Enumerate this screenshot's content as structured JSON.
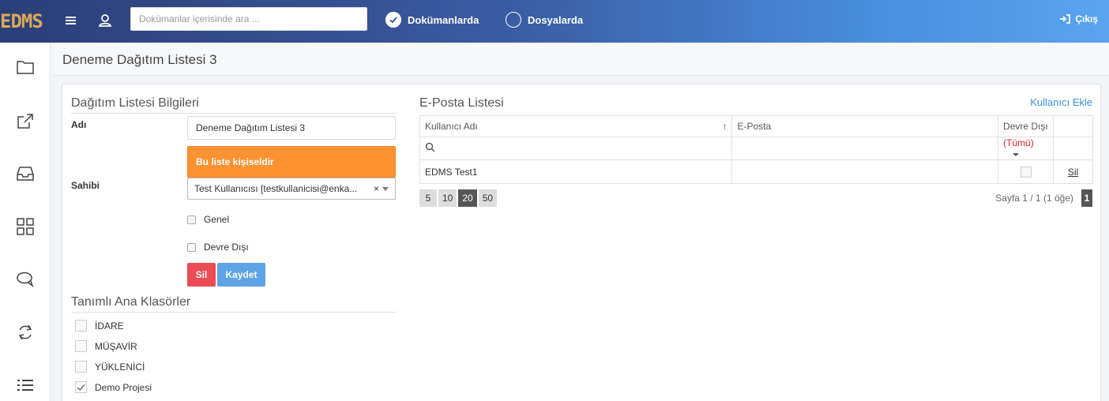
{
  "app": {
    "logo": "EDMS"
  },
  "header": {
    "search_placeholder": "Dokümanlar içerisinde ara ...",
    "search_value": "",
    "radio_documents": "Dokümanlarda",
    "radio_files": "Dosyalarda",
    "selected": "documents",
    "logout_label": "Çıkış"
  },
  "page": {
    "title": "Deneme Dağıtım Listesi 3"
  },
  "info": {
    "heading": "Dağıtım Listesi Bilgileri",
    "name_label": "Adı",
    "name_value": "Deneme Dağıtım Listesi 3",
    "notice": "Bu liste kişiseldir",
    "owner_label": "Sahibi",
    "owner_value": "Test Kullanıcısı [testkullanicisi@enka...",
    "general_label": "Genel",
    "general_checked": false,
    "disabled_label": "Devre Dışı",
    "disabled_checked": false,
    "delete_button": "Sil",
    "save_button": "Kaydet"
  },
  "folders": {
    "heading": "Tanımlı Ana Klasörler",
    "items": [
      {
        "label": "İDARE",
        "checked": false
      },
      {
        "label": "MÜŞAVİR",
        "checked": false
      },
      {
        "label": "YÜKLENİCİ",
        "checked": false
      },
      {
        "label": "Demo Projesi",
        "checked": true
      }
    ]
  },
  "email_list": {
    "heading": "E-Posta Listesi",
    "add_user": "Kullanıcı Ekle",
    "columns": [
      "Kullanıcı Adı",
      "E-Posta",
      "Devre Dışı"
    ],
    "sort_indicator": "↑",
    "filter_all": "(Tümü)",
    "rows": [
      {
        "user": "EDMS Test1",
        "email": "",
        "disabled": false,
        "action": "Sil"
      }
    ],
    "page_sizes": [
      "5",
      "10",
      "20",
      "50"
    ],
    "active_page_size": "20",
    "page_info": "Sayfa 1 / 1 (1 öğe)",
    "current_page": "1"
  },
  "colors": {
    "accent": "#4a8fe0",
    "notice": "#fd9232",
    "danger": "#eb4b55",
    "primary": "#5da3e6"
  }
}
